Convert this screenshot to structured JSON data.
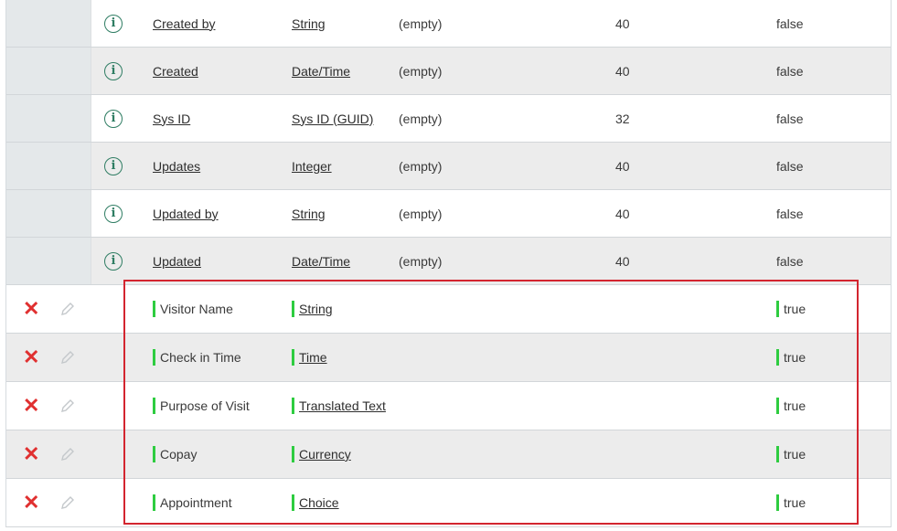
{
  "system_rows": [
    {
      "label": "Created by",
      "type": "String",
      "reference": "(empty)",
      "max_length": "40",
      "active": "false"
    },
    {
      "label": "Created",
      "type": "Date/Time",
      "reference": "(empty)",
      "max_length": "40",
      "active": "false"
    },
    {
      "label": "Sys ID",
      "type": "Sys ID (GUID)",
      "reference": "(empty)",
      "max_length": "32",
      "active": "false"
    },
    {
      "label": "Updates",
      "type": "Integer",
      "reference": "(empty)",
      "max_length": "40",
      "active": "false"
    },
    {
      "label": "Updated by",
      "type": "String",
      "reference": "(empty)",
      "max_length": "40",
      "active": "false"
    },
    {
      "label": "Updated",
      "type": "Date/Time",
      "reference": "(empty)",
      "max_length": "40",
      "active": "false"
    }
  ],
  "new_rows": [
    {
      "label": "Visitor Name",
      "type": "String",
      "active": "true"
    },
    {
      "label": "Check in Time",
      "type": "Time",
      "active": "true"
    },
    {
      "label": "Purpose of Visit",
      "type": "Translated Text",
      "active": "true"
    },
    {
      "label": "Copay",
      "type": "Currency",
      "active": "true"
    },
    {
      "label": "Appointment",
      "type": "Choice",
      "active": "true"
    }
  ],
  "icons": {
    "info": "info-circle-icon",
    "delete": "delete-x-icon",
    "edit": "pencil-icon"
  },
  "colors": {
    "info": "#2f7d63",
    "delete": "#e03030",
    "changed_marker": "#2ecc40",
    "highlight": "#d3252f"
  }
}
